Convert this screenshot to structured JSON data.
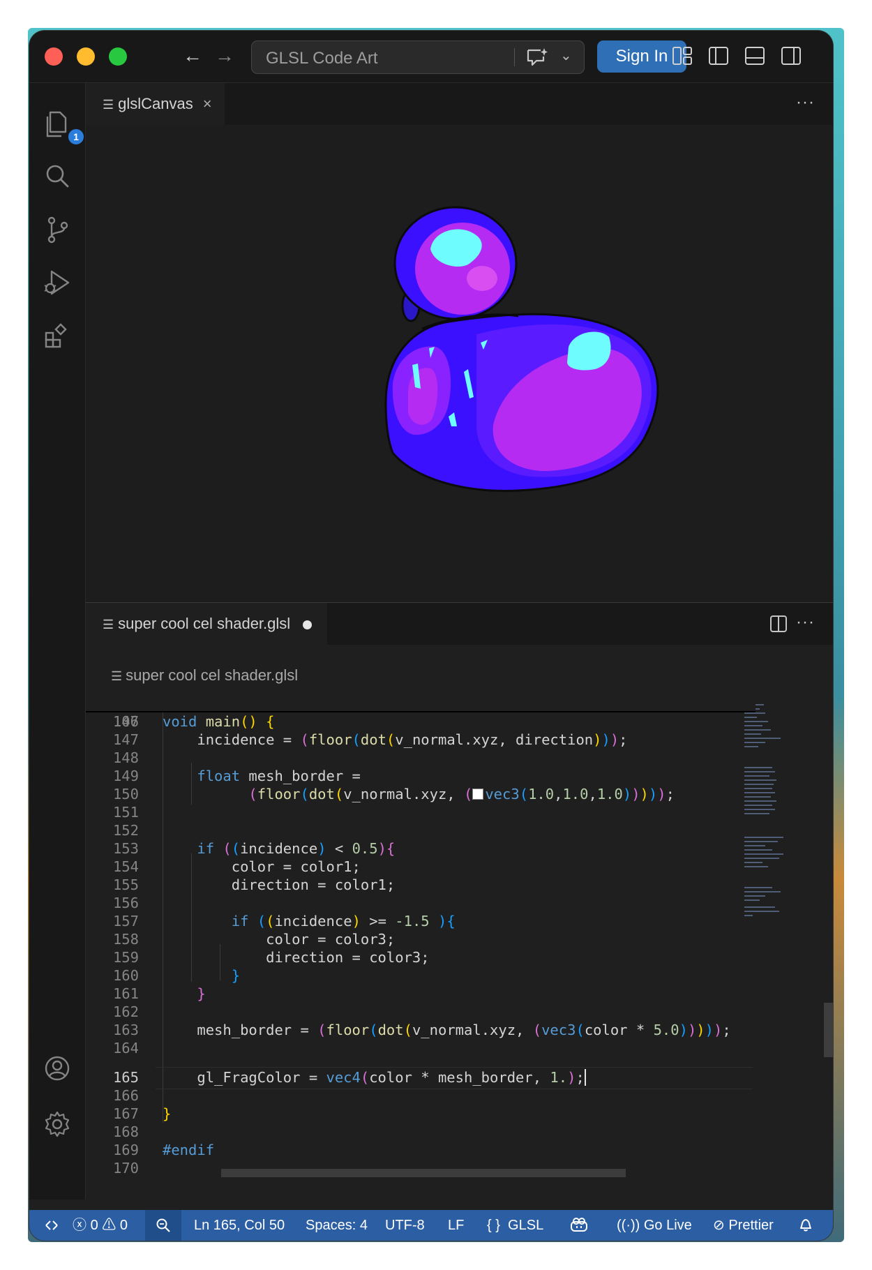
{
  "window": {
    "command_center_title": "GLSL Code Art",
    "sign_in_label": "Sign In"
  },
  "activity_bar": {
    "explorer_badge": "1"
  },
  "preview_tab": {
    "label": "glslCanvas",
    "close_glyph": "×",
    "more_glyph": "···"
  },
  "editor_tab": {
    "label": "super cool cel shader.glsl",
    "more_glyph": "···"
  },
  "breadcrumb": {
    "file": "super cool cel shader.glsl"
  },
  "code": {
    "sticky_line_number": "107",
    "current_line": "165",
    "line_numbers": [
      "146",
      "147",
      "148",
      "149",
      "150",
      "151",
      "152",
      "153",
      "154",
      "155",
      "156",
      "157",
      "158",
      "159",
      "160",
      "161",
      "162",
      "163",
      "164",
      "165",
      "166",
      "167",
      "168",
      "169",
      "170"
    ]
  },
  "status_bar": {
    "remote_icon": "remote-icon",
    "errors": "0",
    "warnings": "0",
    "cursor_position": "Ln 165, Col 50",
    "indentation": "Spaces: 4",
    "encoding": "UTF-8",
    "eol": "LF",
    "language_braces": "{ }",
    "language": "GLSL",
    "go_live": "Go Live",
    "prettier": "Prettier"
  },
  "colors": {
    "status_bar": "#2c5ea3",
    "sign_in": "#2f6fb6",
    "badge": "#2b7ddb",
    "shader_violet": "#3a10ff",
    "shader_magenta": "#b52bf2",
    "shader_highlight": "#6ffcff"
  }
}
